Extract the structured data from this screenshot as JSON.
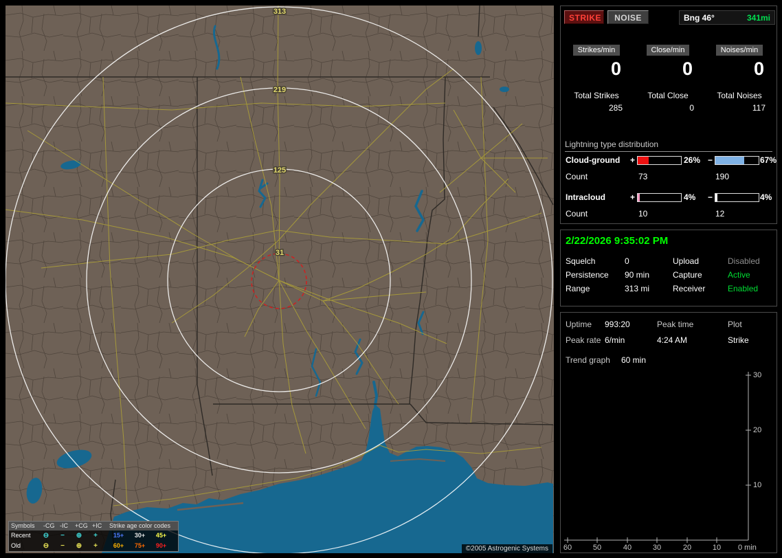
{
  "map": {
    "ring_labels": [
      "313",
      "219",
      "125",
      "31"
    ],
    "legend": {
      "symbols_header": "Symbols",
      "columns": [
        "-CG",
        "-IC",
        "+CG",
        "+IC"
      ],
      "symbols": [
        "⊖",
        "−",
        "⊕",
        "+"
      ],
      "recent_label": "Recent",
      "old_label": "Old",
      "recent_color": "#3fd6d6",
      "old_color": "#e6e055",
      "age_header": "Strike age color codes",
      "ages": [
        {
          "text": "15+",
          "color": "#4d79ff"
        },
        {
          "text": "30+",
          "color": "#e8e8e8"
        },
        {
          "text": "45+",
          "color": "#ffff4d"
        },
        {
          "text": "60+",
          "color": "#ffb300"
        },
        {
          "text": "75+",
          "color": "#ff6a00"
        },
        {
          "text": "90+",
          "color": "#ff1f1f"
        }
      ]
    },
    "copyright": "©2005 Astrogenic Systems",
    "colors": {
      "land": "#6e6156",
      "water": "#176890",
      "road": "#a89b3a",
      "range_ring": "#ffffff",
      "alarm_ring": "#cf2020",
      "ring_label": "#e3d96d"
    }
  },
  "panel": {
    "strike_button": "STRIKE",
    "noise_button": "NOISE",
    "bearing": {
      "label": "Bng 46°",
      "value": "341mi",
      "value_color": "#00e050"
    },
    "rates": [
      {
        "label": "Strikes/min",
        "value": "0"
      },
      {
        "label": "Close/min",
        "value": "0"
      },
      {
        "label": "Noises/min",
        "value": "0"
      }
    ],
    "totals": [
      {
        "label": "Total Strikes",
        "value": "285"
      },
      {
        "label": "Total Close",
        "value": "0"
      },
      {
        "label": "Total Noises",
        "value": "117"
      }
    ],
    "distribution": {
      "title": "Lightning type distribution",
      "plus_sign": "+",
      "minus_sign": "−",
      "count_label": "Count",
      "rows": [
        {
          "label": "Cloud-ground",
          "plus_pct_text": "26%",
          "plus_pct": 26,
          "plus_color": "#ee1111",
          "minus_pct_text": "67%",
          "minus_pct": 67,
          "minus_color": "#7fb2e5",
          "plus_count": "73",
          "minus_count": "190"
        },
        {
          "label": "Intracloud",
          "plus_pct_text": "4%",
          "plus_pct": 4,
          "plus_color": "#f49ac1",
          "minus_pct_text": "4%",
          "minus_pct": 4,
          "minus_color": "#f2f2f2",
          "plus_count": "10",
          "minus_count": "12"
        }
      ]
    },
    "status": {
      "datetime": "2/22/2026 9:35:02 PM",
      "datetime_color": "#00ff00",
      "rows": [
        {
          "label1": "Squelch",
          "value1": "0",
          "label2": "Upload",
          "value2": "Disabled",
          "value2_color": "#8f8f8f"
        },
        {
          "label1": "Persistence",
          "value1": "90 min",
          "label2": "Capture",
          "value2": "Active",
          "value2_color": "#00dd33"
        },
        {
          "label1": "Range",
          "value1": "313 mi",
          "label2": "Receiver",
          "value2": "Enabled",
          "value2_color": "#00dd33"
        }
      ]
    },
    "stats": {
      "uptime_label": "Uptime",
      "uptime_value": "993:20",
      "peak_time_label": "Peak time",
      "peak_time_value": "4:24 AM",
      "plot_label": "Plot",
      "plot_value": "Strike",
      "peak_rate_label": "Peak rate",
      "peak_rate_value": "6/min",
      "trend_label": "Trend graph",
      "trend_value": "60 min"
    }
  },
  "chart_data": {
    "type": "line",
    "title": "Trend graph",
    "window_minutes": 60,
    "xlabel": "min",
    "x_ticks": [
      "60",
      "50",
      "40",
      "30",
      "20",
      "10"
    ],
    "x_end_label": "0 min",
    "y_ticks": [
      "30",
      "20",
      "10"
    ],
    "ylim": [
      0,
      30
    ],
    "grid": false,
    "legend_position": "none",
    "series": [
      {
        "name": "Strike",
        "values": []
      }
    ]
  }
}
